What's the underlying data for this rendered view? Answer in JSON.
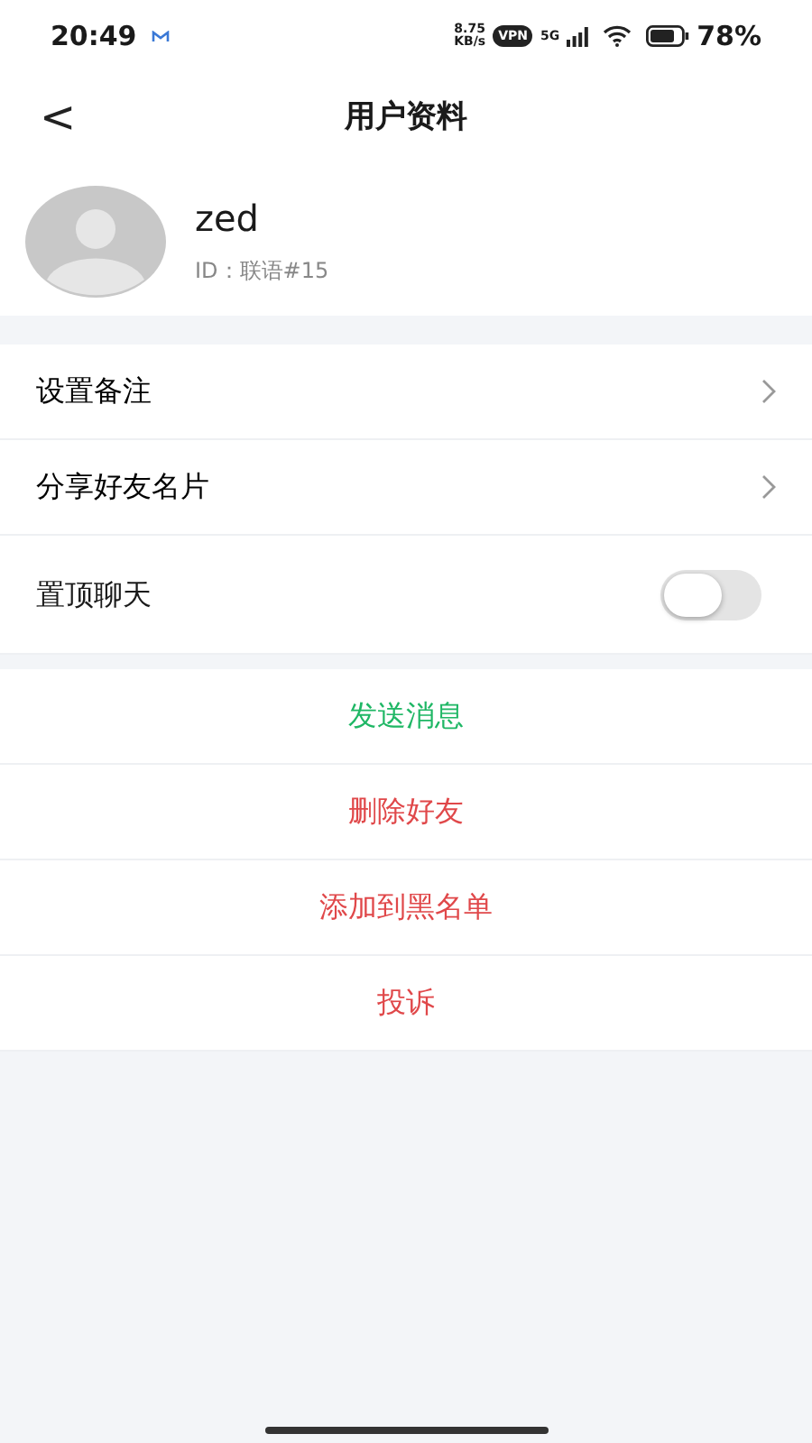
{
  "status_bar": {
    "time": "20:49",
    "speed_value": "8.75",
    "speed_unit": "KB/s",
    "vpn": "VPN",
    "network": "5G",
    "battery": "78%"
  },
  "header": {
    "back": "<",
    "title": "用户资料"
  },
  "profile": {
    "name": "zed",
    "id": "ID：联语#15"
  },
  "settings": [
    {
      "label": "设置备注",
      "kind": "link"
    },
    {
      "label": "分享好友名片",
      "kind": "link"
    },
    {
      "label": "置顶聊天",
      "kind": "switch",
      "on": false
    }
  ],
  "actions": [
    {
      "label": "发送消息",
      "color": "#1fb765"
    },
    {
      "label": "删除好友",
      "color": "#e0484a"
    },
    {
      "label": "添加到黑名单",
      "color": "#e0484a"
    },
    {
      "label": "投诉",
      "color": "#e0484a"
    }
  ]
}
